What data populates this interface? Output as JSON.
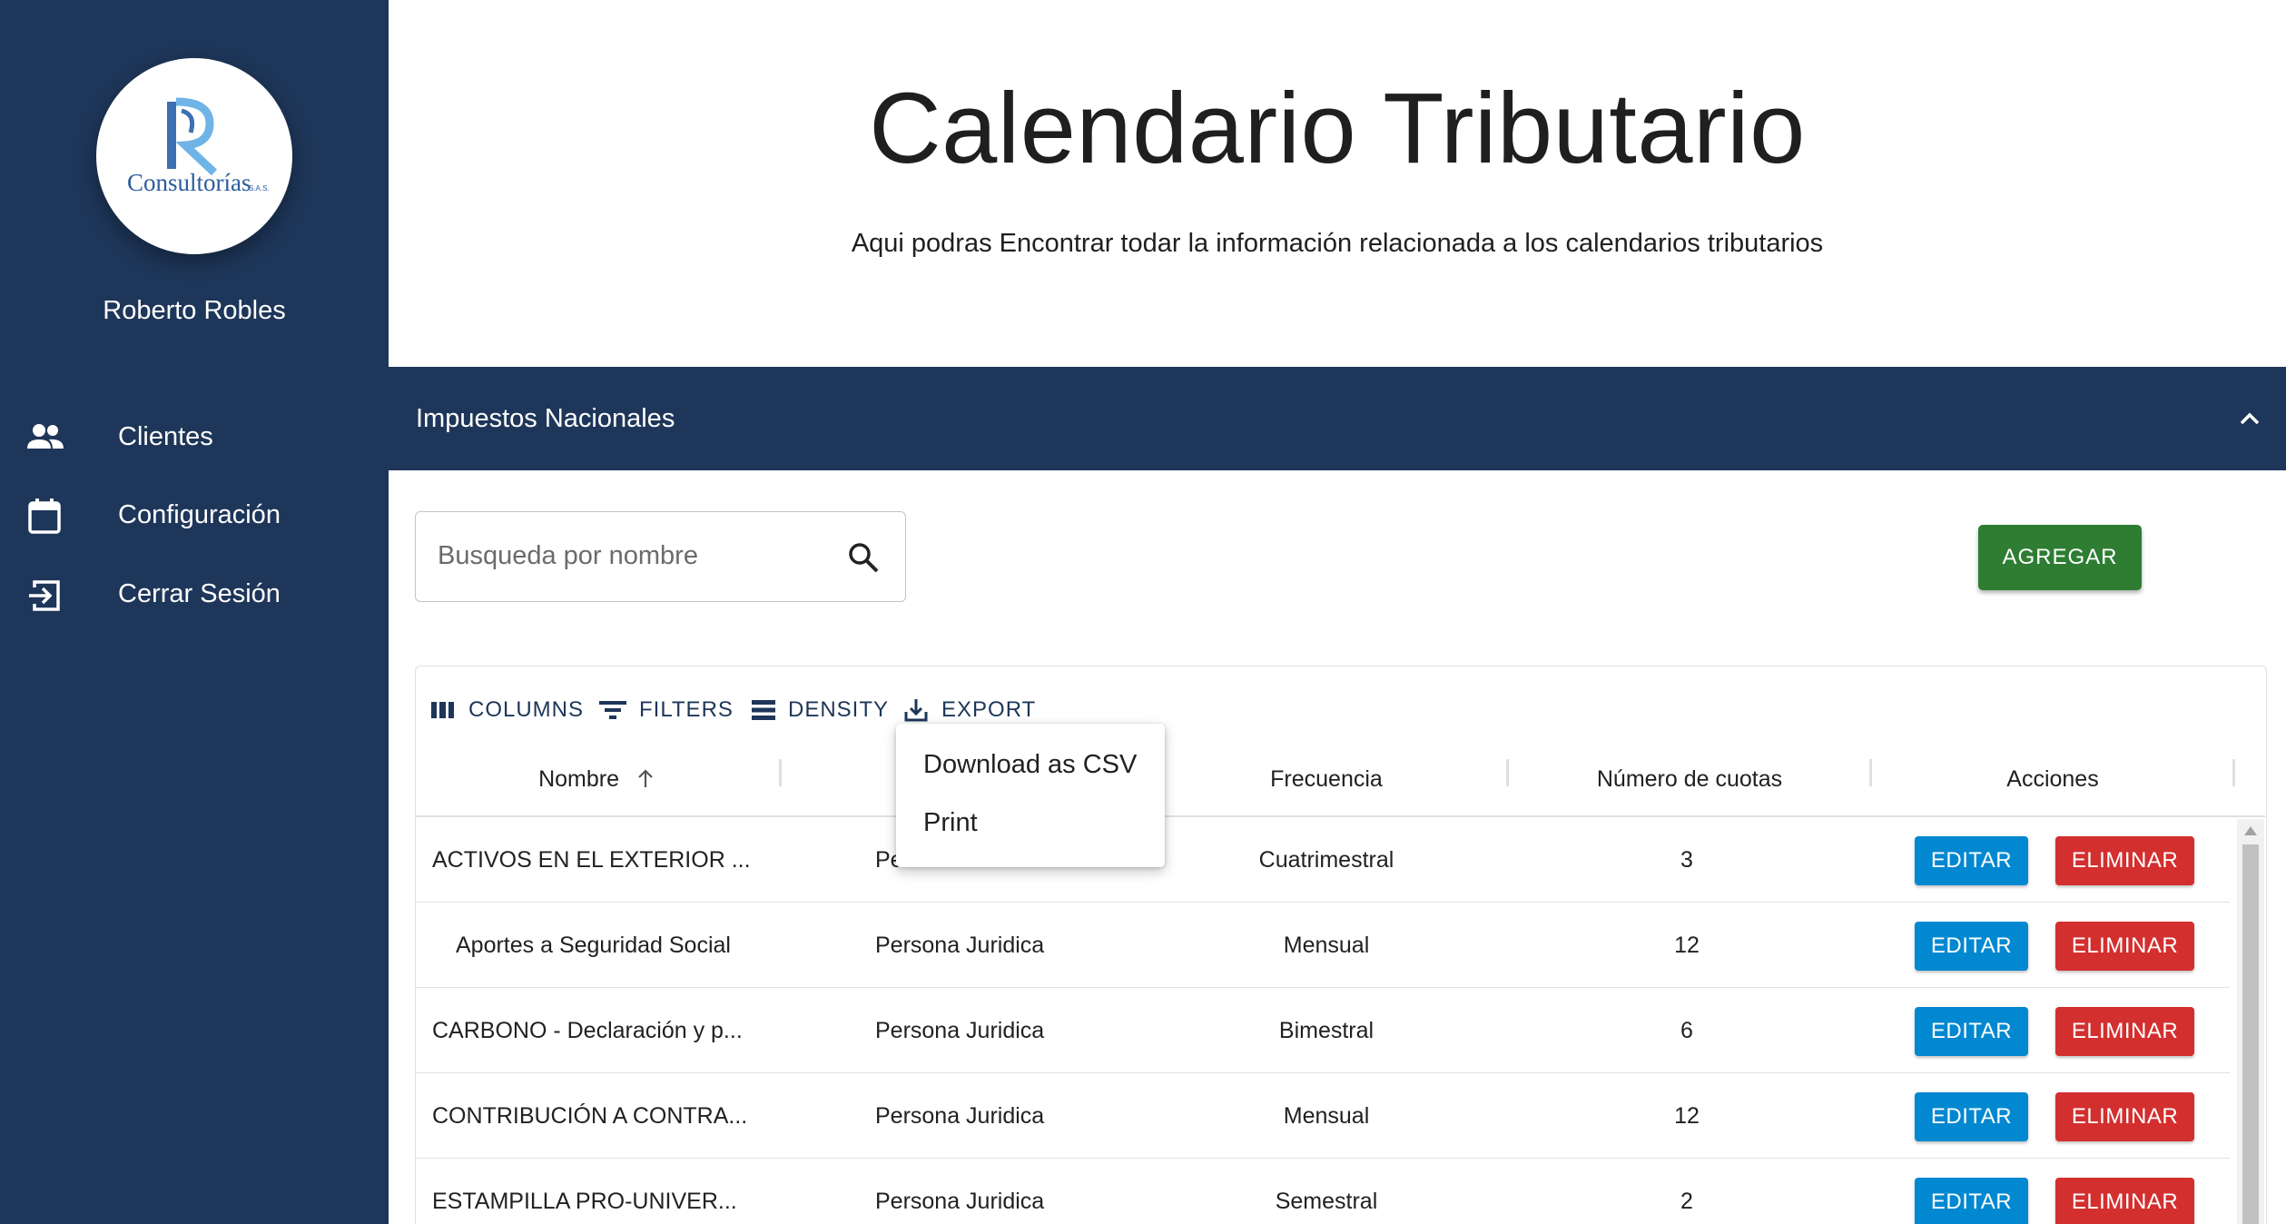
{
  "sidebar": {
    "logo_text": "Consultorías",
    "logo_suffix": "S.A.S.",
    "logo_letter": "R",
    "user_name": "Roberto Robles",
    "items": [
      {
        "label": "Clientes",
        "icon": "people-icon"
      },
      {
        "label": "Configuración",
        "icon": "calendar-icon"
      },
      {
        "label": "Cerrar Sesión",
        "icon": "logout-icon"
      }
    ]
  },
  "header": {
    "title": "Calendario Tributario",
    "subtitle": "Aqui podras Encontrar todar la información relacionada a los calendarios tributarios"
  },
  "accordion": {
    "title": "Impuestos Nacionales",
    "expanded": true
  },
  "search": {
    "placeholder": "Busqueda por nombre",
    "value": ""
  },
  "add_button": "AGREGAR",
  "toolbar": {
    "columns": "COLUMNS",
    "filters": "FILTERS",
    "density": "DENSITY",
    "export": "EXPORT"
  },
  "export_menu": {
    "items": [
      "Download as CSV",
      "Print"
    ]
  },
  "table": {
    "columns": [
      "Nombre",
      "",
      "Frecuencia",
      "Número de cuotas",
      "Acciones"
    ],
    "sort": {
      "column": "Nombre",
      "direction": "asc"
    },
    "rows": [
      {
        "nombre": "ACTIVOS EN EL EXTERIOR ...",
        "tipo": "Pe",
        "frecuencia": "Cuatrimestral",
        "cuotas": "3"
      },
      {
        "nombre": "Aportes a Seguridad Social",
        "tipo": "Persona Juridica",
        "frecuencia": "Mensual",
        "cuotas": "12"
      },
      {
        "nombre": "CARBONO - Declaración y p...",
        "tipo": "Persona Juridica",
        "frecuencia": "Bimestral",
        "cuotas": "6"
      },
      {
        "nombre": "CONTRIBUCIÓN A CONTRA...",
        "tipo": "Persona Juridica",
        "frecuencia": "Mensual",
        "cuotas": "12"
      },
      {
        "nombre": "ESTAMPILLA PRO-UNIVER...",
        "tipo": "Persona Juridica",
        "frecuencia": "Semestral",
        "cuotas": "2"
      }
    ],
    "edit_label": "EDITAR",
    "delete_label": "ELIMINAR"
  },
  "colors": {
    "sidebar_bg": "#1e3659",
    "add_button": "#2e7d32",
    "edit_button": "#0288d1",
    "delete_button": "#d32f2f"
  }
}
